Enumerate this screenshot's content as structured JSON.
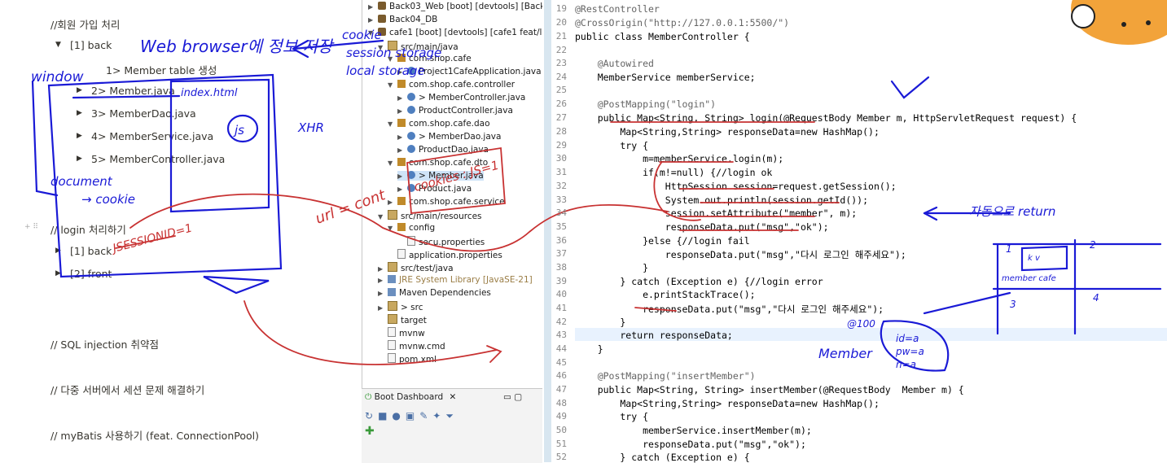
{
  "notes": {
    "title": "//회원 가입 처리",
    "back": "[1] back",
    "items": [
      "1> Member table 생성",
      "2> Member.java",
      "3> MemberDao.java",
      "4> MemberService.java",
      "5> MemberController.java"
    ],
    "login_heading": "// login 처리하기",
    "login_back": "[1] back",
    "login_front": "[2] front",
    "sql": "// SQL injection 취약점",
    "multi": "// 다중 서버에서 세션 문제 해결하기",
    "mybatis": "// myBatis 사용하기 (feat. ConnectionPool)"
  },
  "tree": [
    "Back03_Web [boot] [devtools] [Back03",
    "Back04_DB",
    "cafe1 [boot] [devtools] [cafe1 feat/lo",
    "src/main/java",
    "com.shop.cafe",
    "Project1CafeApplication.java",
    "com.shop.cafe.controller",
    "> MemberController.java",
    "ProductController.java",
    "com.shop.cafe.dao",
    "> MemberDao.java",
    "ProductDao.java",
    "com.shop.cafe.dto",
    "> Member.java",
    "Product.java",
    "com.shop.cafe.service",
    "src/main/resources",
    "config",
    "secu.properties",
    "application.properties",
    "src/test/java",
    "JRE System Library [JavaSE-21]",
    "Maven Dependencies",
    "> src",
    "target",
    "mvnw",
    "mvnw.cmd",
    "pom.xml"
  ],
  "boot_tab": "Boot Dashboard",
  "line_numbers": [
    "19",
    "20",
    "21",
    "22",
    "23",
    "24",
    "25",
    "26",
    "27",
    "28",
    "29",
    "30",
    "31",
    "32",
    "33",
    "34",
    "35",
    "36",
    "37",
    "38",
    "39",
    "40",
    "41",
    "42",
    "43",
    "44",
    "45",
    "46",
    "47",
    "48",
    "49",
    "50",
    "51",
    "52"
  ],
  "code": {
    "l19": "@RestController",
    "l20": "@CrossOrigin(\"http://127.0.0.1:5500/\")",
    "l21": "public class MemberController {",
    "l23": "    @Autowired",
    "l24": "    MemberService memberService;",
    "l26": "    @PostMapping(\"login\")",
    "l27": "    public Map<String, String> login(@RequestBody Member m, HttpServletRequest request) {",
    "l28": "        Map<String,String> responseData=new HashMap();",
    "l29": "        try {",
    "l30": "            m=memberService.login(m);",
    "l31": "            if(m!=null) {//login ok",
    "l32": "                HttpSession session=request.getSession();",
    "l33": "                System.out.println(session.getId());",
    "l34": "                session.setAttribute(\"member\", m);",
    "l35": "                responseData.put(\"msg\",\"ok\");",
    "l36": "            }else {//login fail",
    "l37": "                responseData.put(\"msg\",\"다시 로그인 해주세요\");",
    "l38": "            }",
    "l39": "        } catch (Exception e) {//login error",
    "l40": "            e.printStackTrace();",
    "l41": "            responseData.put(\"msg\",\"다시 로그인 해주세요\");",
    "l42": "        }",
    "l43": "        return responseData;",
    "l44": "    }",
    "l46": "    @PostMapping(\"insertMember\")",
    "l47": "    public Map<String, String> insertMember(@RequestBody  Member m) {",
    "l48": "        Map<String,String> responseData=new HashMap();",
    "l49": "        try {",
    "l50": "            memberService.insertMember(m);",
    "l51": "            responseData.put(\"msg\",\"ok\");",
    "l52": "        } catch (Exception e) {"
  },
  "ink_text": {
    "web_storage": "Web browser에 정보 저장",
    "cookie": "cookie",
    "session_storage": "session storage",
    "local_storage": "local storage",
    "window": "window",
    "index": "index.html",
    "js": "js",
    "xhr": "XHR",
    "document": "document",
    "doc_cookie": "→ cookie",
    "jsession": "JSESSIONID=1",
    "url": "url = cont",
    "cookies_js": "cookies : JS=1",
    "auto_return": "자동으로 return",
    "member": "Member",
    "at100": "@100",
    "id": "id=a",
    "pw": "pw=a",
    "n": "n=a",
    "grid_n": "1",
    "grid_2": "2",
    "grid_3": "3",
    "grid_4": "4",
    "kv": "k v",
    "member_cafe": "member cafe"
  }
}
